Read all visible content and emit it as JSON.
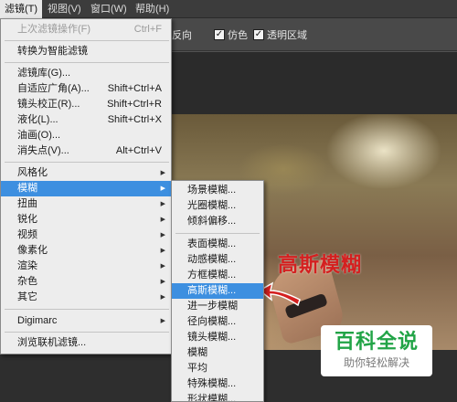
{
  "menubar": {
    "items": [
      {
        "label": "滤镜(T)"
      },
      {
        "label": "视图(V)"
      },
      {
        "label": "窗口(W)"
      },
      {
        "label": "帮助(H)"
      }
    ]
  },
  "options": {
    "reverse": {
      "label": "反向"
    },
    "dither": {
      "label": "仿色",
      "checked": true
    },
    "transparency": {
      "label": "透明区域",
      "checked": true
    },
    "checkmark": "✓"
  },
  "filter_menu": {
    "last_filter": {
      "label": "上次滤镜操作(F)",
      "shortcut": "Ctrl+F"
    },
    "smart_filter": {
      "label": "转换为智能滤镜"
    },
    "gallery": {
      "label": "滤镜库(G)..."
    },
    "adaptive_wide_angle": {
      "label": "自适应广角(A)...",
      "shortcut": "Shift+Ctrl+A"
    },
    "lens_correction": {
      "label": "镜头校正(R)...",
      "shortcut": "Shift+Ctrl+R"
    },
    "liquify": {
      "label": "液化(L)...",
      "shortcut": "Shift+Ctrl+X"
    },
    "oil_paint": {
      "label": "油画(O)..."
    },
    "vanishing_point": {
      "label": "消失点(V)...",
      "shortcut": "Alt+Ctrl+V"
    },
    "stylize": {
      "label": "风格化"
    },
    "blur": {
      "label": "模糊"
    },
    "distort": {
      "label": "扭曲"
    },
    "sharpen": {
      "label": "锐化"
    },
    "video": {
      "label": "视频"
    },
    "pixelate": {
      "label": "像素化"
    },
    "render": {
      "label": "渲染"
    },
    "noise": {
      "label": "杂色"
    },
    "other": {
      "label": "其它"
    },
    "digimarc": {
      "label": "Digimarc"
    },
    "browse_online": {
      "label": "浏览联机滤镜..."
    }
  },
  "blur_submenu": {
    "field_blur": "场景模糊...",
    "iris_blur": "光圈模糊...",
    "tilt_shift": "倾斜偏移...",
    "surface_blur": "表面模糊...",
    "motion_blur": "动感模糊...",
    "box_blur": "方框模糊...",
    "gaussian_blur": "高斯模糊...",
    "blur_more": "进一步模糊",
    "radial_blur": "径向模糊...",
    "lens_blur": "镜头模糊...",
    "blur": "模糊",
    "average": "平均",
    "smart_blur": "特殊模糊...",
    "shape_blur": "形状模糊..."
  },
  "annotation": {
    "text": "高斯模糊",
    "color": "#d42020"
  },
  "watermark": {
    "title": "百科全说",
    "subtitle": "助你轻松解决",
    "color": "#22a447"
  },
  "colors": {
    "highlight": "#3d8fe0"
  }
}
